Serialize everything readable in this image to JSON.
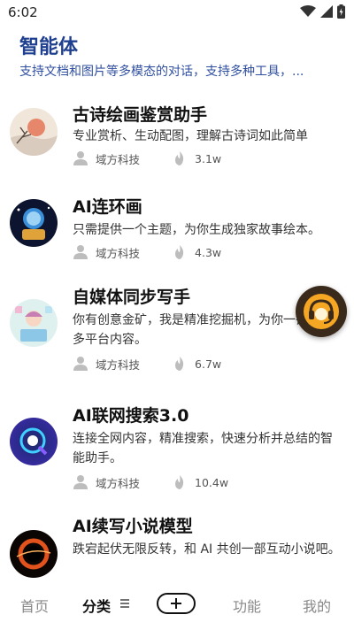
{
  "status_bar": {
    "time": "6:02"
  },
  "header": {
    "title": "智能体",
    "subtitle": "支持文档和图片等多模态的对话，支持多种工具，..."
  },
  "items": [
    {
      "title": "古诗绘画鉴赏助手",
      "desc": "专业赏析、生动配图，理解古诗词如此简单",
      "author": "域方科技",
      "views": "3.1w"
    },
    {
      "title": "AI连环画",
      "desc": "只需提供一个主题，为你生成独家故事绘本。",
      "author": "域方科技",
      "views": "4.3w"
    },
    {
      "title": "自媒体同步写手",
      "desc": "你有创意金矿，我是精准挖掘机，为你一键通发多平台内容。",
      "author": "域方科技",
      "views": "6.7w"
    },
    {
      "title": "AI联网搜索3.0",
      "desc": "连接全网内容，精准搜索，快速分析并总结的智能助手。",
      "author": "域方科技",
      "views": "10.4w"
    },
    {
      "title": "AI续写小说模型",
      "desc": "跌宕起伏无限反转，和 AI 共创一部互动小说吧。",
      "author": "",
      "views": ""
    }
  ],
  "nav": {
    "home": "首页",
    "category": "分类",
    "features": "功能",
    "mine": "我的"
  }
}
